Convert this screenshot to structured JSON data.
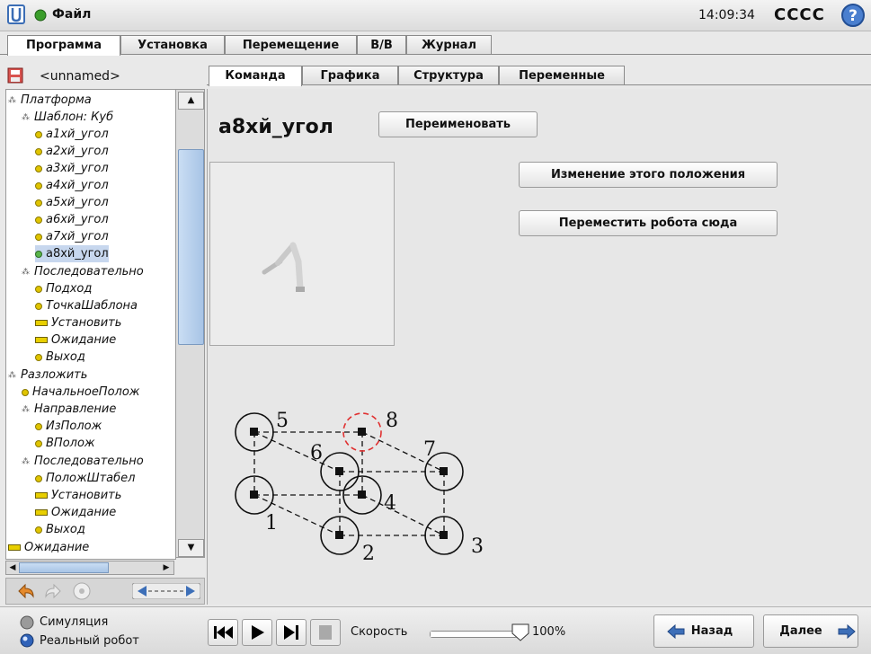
{
  "header": {
    "file_menu": "Файл",
    "time": "14:09:34",
    "robot_name": "CCCC",
    "help_icon": "help-icon",
    "logo_icon": "ur-logo-icon",
    "status_icon": "status-dot-icon"
  },
  "main_tabs": [
    "Программа",
    "Установка",
    "Перемещение",
    "В/В",
    "Журнал"
  ],
  "program_name": "<unnamed>",
  "sub_tabs": [
    "Команда",
    "Графика",
    "Структура",
    "Переменные"
  ],
  "tree": [
    {
      "label": "Платформа",
      "kind": "group"
    },
    {
      "label": "Шаблон: Куб",
      "kind": "group"
    },
    {
      "label": "a1хй_угол",
      "kind": "waypoint"
    },
    {
      "label": "a2хй_угол",
      "kind": "waypoint"
    },
    {
      "label": "a3хй_угол",
      "kind": "waypoint"
    },
    {
      "label": "a4хй_угол",
      "kind": "waypoint"
    },
    {
      "label": "a5хй_угол",
      "kind": "waypoint"
    },
    {
      "label": "a6хй_угол",
      "kind": "waypoint"
    },
    {
      "label": "a7хй_угол",
      "kind": "waypoint"
    },
    {
      "label": "a8хй_угол",
      "kind": "waypoint-selected"
    },
    {
      "label": "Последовательно",
      "kind": "group"
    },
    {
      "label": "Подход",
      "kind": "waypoint"
    },
    {
      "label": "ТочкаШаблона",
      "kind": "waypoint"
    },
    {
      "label": "Установить",
      "kind": "action"
    },
    {
      "label": "Ожидание",
      "kind": "action"
    },
    {
      "label": "Выход",
      "kind": "waypoint"
    },
    {
      "label": "Разложить",
      "kind": "group"
    },
    {
      "label": "НачальноеПолож",
      "kind": "waypoint"
    },
    {
      "label": "Направление",
      "kind": "group"
    },
    {
      "label": "ИзПолож",
      "kind": "waypoint"
    },
    {
      "label": "ВПолож",
      "kind": "waypoint"
    },
    {
      "label": "Последовательно",
      "kind": "group"
    },
    {
      "label": "ПоложШтабел",
      "kind": "waypoint"
    },
    {
      "label": "Установить",
      "kind": "action"
    },
    {
      "label": "Ожидание",
      "kind": "action"
    },
    {
      "label": "Выход",
      "kind": "waypoint"
    },
    {
      "label": "Ожидание",
      "kind": "action"
    }
  ],
  "command": {
    "title": "a8хй_угол",
    "rename_button": "Переименовать",
    "change_position_button": "Изменение этого положения",
    "move_robot_button": "Переместить робота сюда"
  },
  "pattern": {
    "labels": [
      "5",
      "8",
      "6",
      "7",
      "4",
      "1",
      "2",
      "3"
    ]
  },
  "footer": {
    "simulation": "Симуляция",
    "real_robot": "Реальный робот",
    "speed_label": "Скорость",
    "speed_value": "100%",
    "speed_fraction": 1.0,
    "back_button": "Назад",
    "next_button": "Далее"
  },
  "colors": {
    "accent": "#3b6db5",
    "selection": "#c7d7ee",
    "highlight_circle": "#e03030"
  }
}
